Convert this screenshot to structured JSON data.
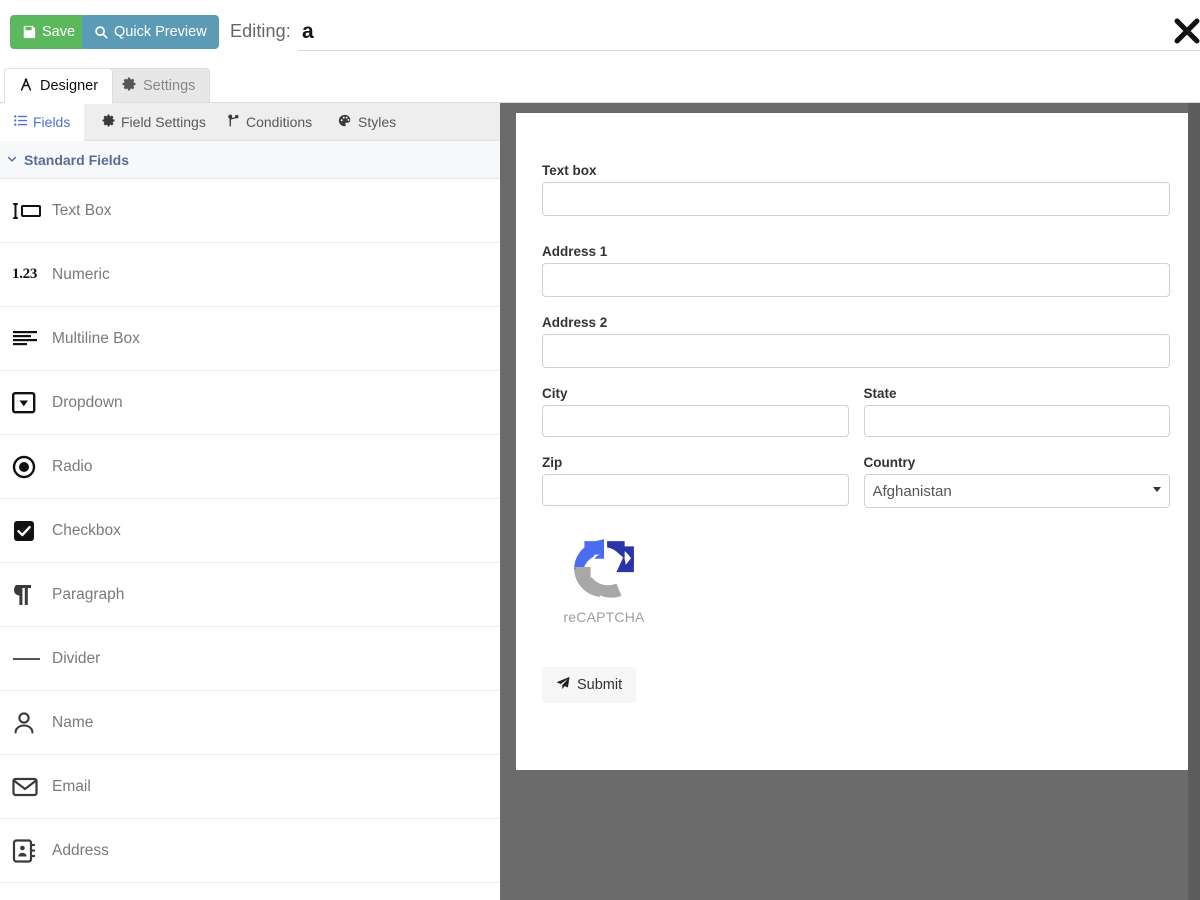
{
  "toolbar": {
    "save_label": "Save",
    "save_icon": "floppy-save-icon",
    "save_color": "#5cb85c",
    "preview_label": "Quick Preview",
    "preview_icon": "magnifier-search-icon",
    "preview_color": "#5b9bb5",
    "editing_label": "Editing:",
    "form_title_value": "a",
    "form_title_placeholder": "",
    "close_icon": "close-x-icon"
  },
  "main_tabs": [
    {
      "label": "Designer",
      "icon": "drafting-compass-icon",
      "active": true
    },
    {
      "label": "Settings",
      "icon": "gear-icon",
      "active": false
    }
  ],
  "sub_tabs": [
    {
      "label": "Fields",
      "icon": "list-ul-icon",
      "active": true
    },
    {
      "label": "Field Settings",
      "icon": "gear-icon",
      "active": false
    },
    {
      "label": "Conditions",
      "icon": "code-branch-icon",
      "active": false
    },
    {
      "label": "Styles",
      "icon": "palette-icon",
      "active": false
    }
  ],
  "field_group": {
    "title": "Standard Fields",
    "expanded": true,
    "chevron_icon": "chevron-down-icon"
  },
  "fields": [
    {
      "label": "Text Box",
      "icon": "text-box-icon"
    },
    {
      "label": "Numeric",
      "icon": "numeric-123-icon",
      "glyph": "1.23"
    },
    {
      "label": "Multiline Box",
      "icon": "multiline-lines-icon"
    },
    {
      "label": "Dropdown",
      "icon": "dropdown-caret-box-icon"
    },
    {
      "label": "Radio",
      "icon": "radio-circle-icon"
    },
    {
      "label": "Checkbox",
      "icon": "checkbox-checked-icon"
    },
    {
      "label": "Paragraph",
      "icon": "paragraph-pilcrow-icon"
    },
    {
      "label": "Divider",
      "icon": "divider-line-icon"
    },
    {
      "label": "Name",
      "icon": "user-person-icon"
    },
    {
      "label": "Email",
      "icon": "envelope-email-icon"
    },
    {
      "label": "Address",
      "icon": "address-book-icon"
    }
  ],
  "form_preview": {
    "background_color": "#6b6b6b",
    "card_color": "#ffffff",
    "blocks": [
      {
        "label": "Text box",
        "type": "text",
        "value": "",
        "placeholder": ""
      },
      {
        "label": "Address 1",
        "type": "text",
        "value": "",
        "placeholder": ""
      },
      {
        "label": "Address 2",
        "type": "text",
        "value": "",
        "placeholder": ""
      },
      {
        "label": "City",
        "type": "text",
        "value": "",
        "placeholder": ""
      },
      {
        "label": "State",
        "type": "text",
        "value": "",
        "placeholder": ""
      },
      {
        "label": "Zip",
        "type": "text",
        "value": "",
        "placeholder": ""
      },
      {
        "label": "Country",
        "type": "select",
        "value": "Afghanistan",
        "options": [
          "Afghanistan"
        ]
      }
    ],
    "captcha": {
      "text": "reCAPTCHA",
      "icon": "recaptcha-logo-icon",
      "color_dark": "#2b35a8",
      "color_light": "#4a6cf0",
      "color_gray": "#9aa0a6"
    },
    "submit": {
      "label": "Submit",
      "icon": "paper-plane-icon"
    }
  }
}
